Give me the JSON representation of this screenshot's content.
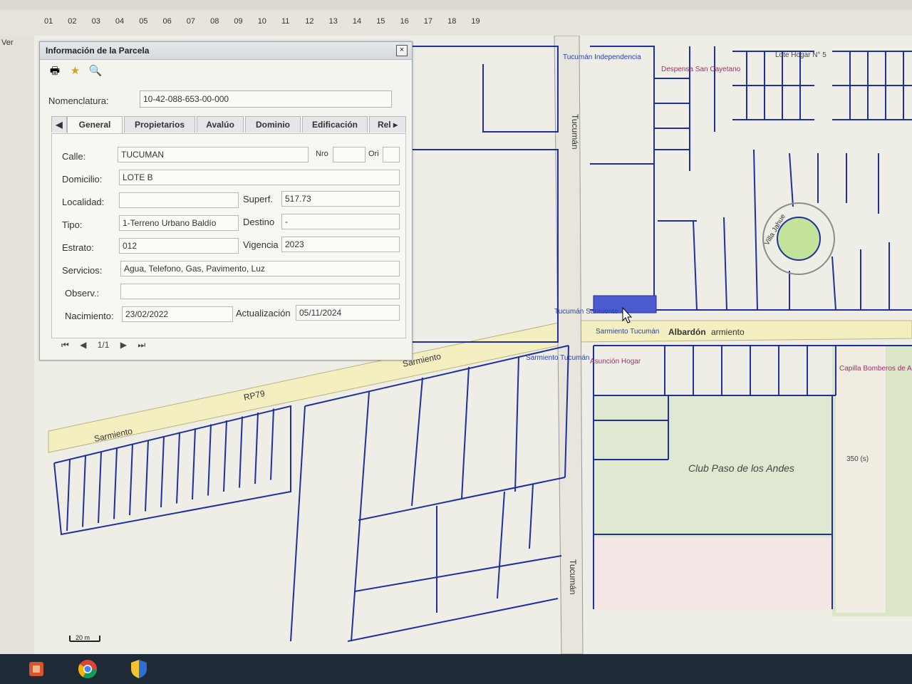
{
  "ruler": {
    "columns": [
      "01",
      "02",
      "03",
      "04",
      "05",
      "06",
      "07",
      "08",
      "09",
      "10",
      "11",
      "12",
      "13",
      "14",
      "15",
      "16",
      "17",
      "18",
      "19"
    ]
  },
  "sidebar": {
    "label": "Ver"
  },
  "parcel_panel": {
    "title": "Información de la Parcela",
    "close_label": "×",
    "toolbar": [
      {
        "name": "print-icon",
        "glyph": "🖶"
      },
      {
        "name": "star-icon",
        "glyph": "★"
      },
      {
        "name": "zoom-icon",
        "glyph": "🔍"
      }
    ],
    "nomenclatura": {
      "label": "Nomenclatura:",
      "value": "10-42-088-653-00-000"
    },
    "tabs": [
      "General",
      "Propietarios",
      "Avalúo",
      "Dominio",
      "Edificación",
      "Rel"
    ],
    "active_tab": "General",
    "fields": {
      "calle": {
        "label": "Calle:",
        "value": "TUCUMAN"
      },
      "nro": {
        "label": "Nro",
        "value": ""
      },
      "ori": {
        "label": "Ori",
        "value": ""
      },
      "domicilio": {
        "label": "Domicilio:",
        "value": "LOTE B"
      },
      "localidad": {
        "label": "Localidad:",
        "value": ""
      },
      "superf": {
        "label": "Superf.",
        "value": "517.73"
      },
      "tipo": {
        "label": "Tipo:",
        "value": "1-Terreno Urbano Baldío"
      },
      "destino": {
        "label": "Destino",
        "value": "-"
      },
      "estrato": {
        "label": "Estrato:",
        "value": "012"
      },
      "vigencia": {
        "label": "Vigencia",
        "value": "2023"
      },
      "servicios": {
        "label": "Servicios:",
        "value": "Agua, Telefono, Gas, Pavimento, Luz"
      },
      "observ": {
        "label": "Observ.:",
        "value": ""
      },
      "nacimiento": {
        "label": "Nacimiento:",
        "value": "23/02/2022"
      },
      "actualizacion": {
        "label": "Actualización",
        "value": "05/11/2024"
      }
    },
    "pager": {
      "page_text": "1/1"
    }
  },
  "map": {
    "streets": [
      "Sarmiento",
      "Sarmiento",
      "RP79",
      "Albardón",
      "armiento",
      "Tucumán",
      "Tucumán",
      "Villa Jahue"
    ],
    "pois": [
      "Tucumán Independencia",
      "Despensa San Cayetano",
      "Lote Hogar N° 5",
      "Tucumán Sarmiento",
      "Sarmiento Tucumán",
      "Sarmiento Tucumán",
      "Asunción Hogar",
      "Capilla Bomberos de Ascot",
      "Club Paso de los Andes",
      "350 (s)"
    ],
    "scale": "20 m",
    "selected_parcel_color": "#4a5ccf"
  },
  "taskbar": {
    "buttons": [
      {
        "name": "app-icon"
      },
      {
        "name": "chrome-icon"
      },
      {
        "name": "shield-app-icon"
      }
    ]
  }
}
